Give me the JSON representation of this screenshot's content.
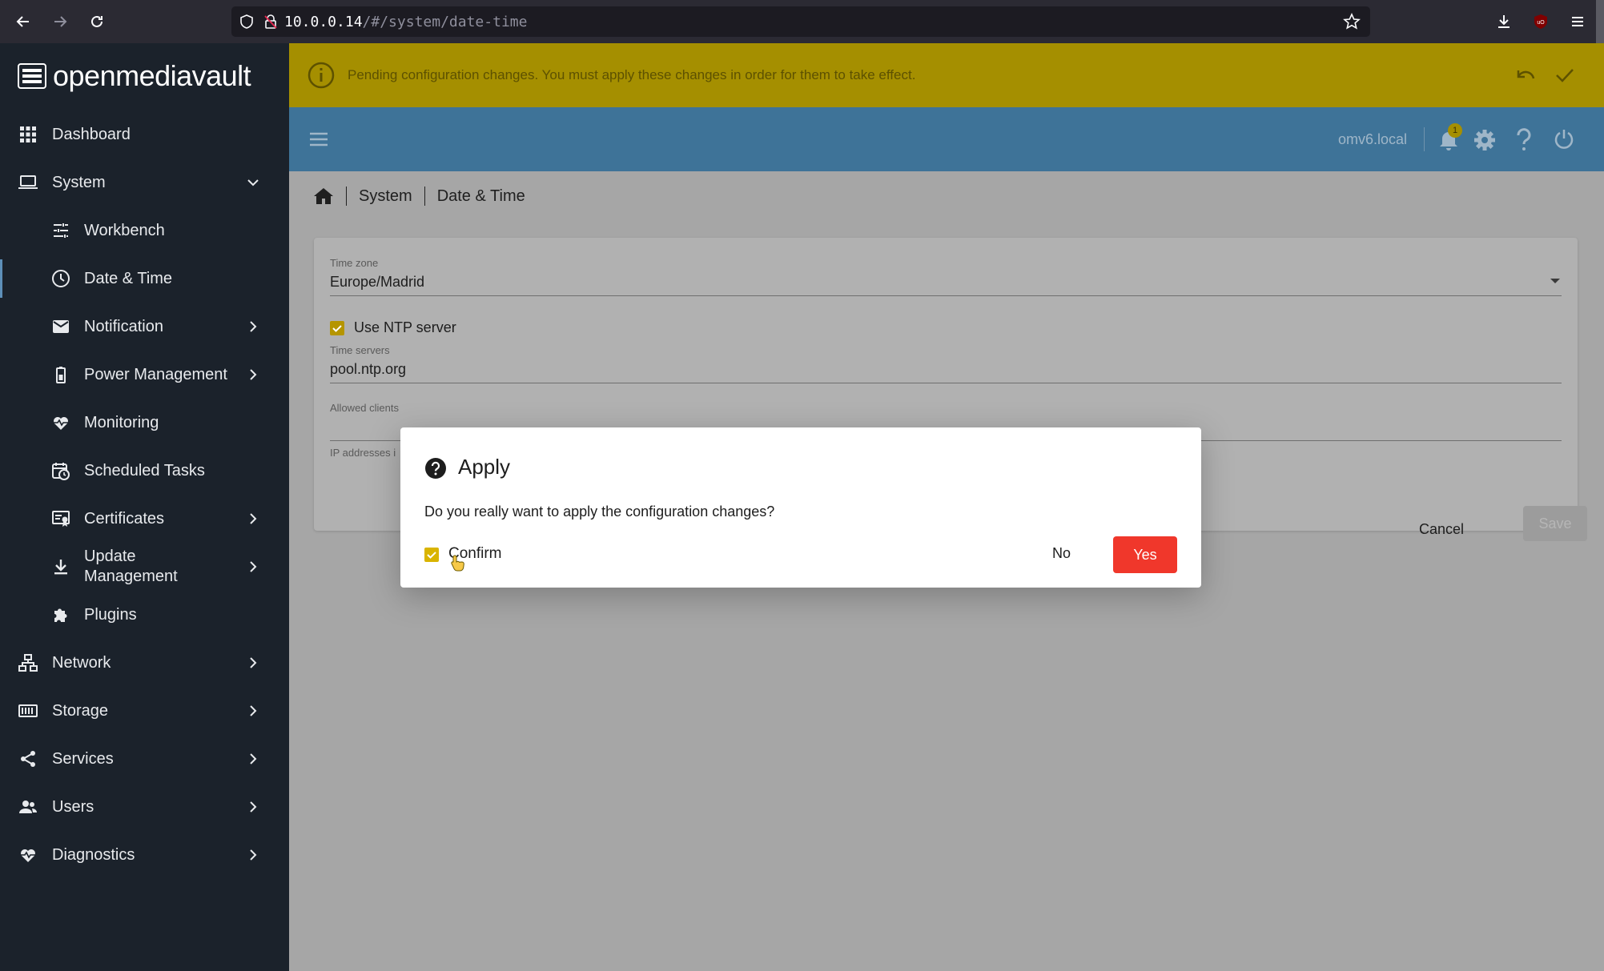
{
  "browser": {
    "url_host": "10.0.0.14",
    "url_path": "/#/system/date-time"
  },
  "sidebar": {
    "logo_text": "openmediavault",
    "items": [
      {
        "label": "Dashboard",
        "icon": "dashboard-icon"
      },
      {
        "label": "System",
        "icon": "laptop-icon",
        "expanded": true
      },
      {
        "label": "Workbench",
        "icon": "tune-icon"
      },
      {
        "label": "Date & Time",
        "icon": "clock-icon",
        "active": true
      },
      {
        "label": "Notification",
        "icon": "mail-icon"
      },
      {
        "label": "Power Management",
        "icon": "battery-icon"
      },
      {
        "label": "Monitoring",
        "icon": "heartbeat-icon"
      },
      {
        "label": "Scheduled Tasks",
        "icon": "calendar-clock-icon"
      },
      {
        "label": "Certificates",
        "icon": "certificate-icon"
      },
      {
        "label": "Update Management",
        "icon": "download-icon"
      },
      {
        "label": "Plugins",
        "icon": "puzzle-icon"
      },
      {
        "label": "Network",
        "icon": "network-icon"
      },
      {
        "label": "Storage",
        "icon": "storage-icon"
      },
      {
        "label": "Services",
        "icon": "share-icon"
      },
      {
        "label": "Users",
        "icon": "users-icon"
      },
      {
        "label": "Diagnostics",
        "icon": "heartbeat-icon"
      }
    ]
  },
  "banner": {
    "message": "Pending configuration changes. You must apply these changes in order for them to take effect."
  },
  "toolbar": {
    "hostname": "omv6.local",
    "notification_count": "1"
  },
  "breadcrumb": {
    "items": [
      "System",
      "Date & Time"
    ]
  },
  "form": {
    "timezone_label": "Time zone",
    "timezone_value": "Europe/Madrid",
    "ntp_label": "Use NTP server",
    "ntp_checked": true,
    "time_servers_label": "Time servers",
    "time_servers_value": "pool.ntp.org",
    "allowed_clients_label": "Allowed clients",
    "allowed_clients_value": "",
    "hint_text": "IP addresses i",
    "cancel_label": "Cancel",
    "save_label": "Save"
  },
  "dialog": {
    "title": "Apply",
    "text": "Do you really want to apply the configuration changes?",
    "confirm_label": "Confirm",
    "confirm_checked": true,
    "no_label": "No",
    "yes_label": "Yes"
  },
  "colors": {
    "accent_yellow": "#d9b400",
    "banner": "#a58f00",
    "toolbar": "#3e7398",
    "yes_button": "#f0372b"
  }
}
